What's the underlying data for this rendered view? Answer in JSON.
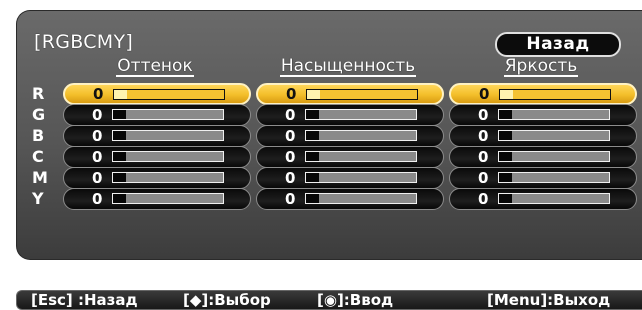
{
  "panel": {
    "title": "[RGBCMY]",
    "back_label": "Назад"
  },
  "columns": [
    "Оттенок",
    "Насыщенность",
    "Яркость"
  ],
  "rows": [
    {
      "label": "R",
      "values": [
        "0",
        "0",
        "0"
      ],
      "levels": [
        0.0,
        0.0,
        0.0
      ]
    },
    {
      "label": "G",
      "values": [
        "0",
        "0",
        "0"
      ],
      "levels": [
        0.0,
        0.0,
        0.0
      ]
    },
    {
      "label": "B",
      "values": [
        "0",
        "0",
        "0"
      ],
      "levels": [
        0.0,
        0.0,
        0.0
      ]
    },
    {
      "label": "C",
      "values": [
        "0",
        "0",
        "0"
      ],
      "levels": [
        0.0,
        0.0,
        0.0
      ]
    },
    {
      "label": "M",
      "values": [
        "0",
        "0",
        "0"
      ],
      "levels": [
        0.0,
        0.0,
        0.0
      ]
    },
    {
      "label": "Y",
      "values": [
        "0",
        "0",
        "0"
      ],
      "levels": [
        0.0,
        0.0,
        0.0
      ]
    }
  ],
  "selected_row": "R",
  "colors": {
    "panel_bg": "#555555",
    "highlight": "#f3be2a",
    "pill": "#111111"
  },
  "footer": {
    "esc": "[Esc] :Назад",
    "select": "[◆]:Выбор",
    "enter": "[◉]:Ввод",
    "menu": "[Menu]:Выход"
  }
}
